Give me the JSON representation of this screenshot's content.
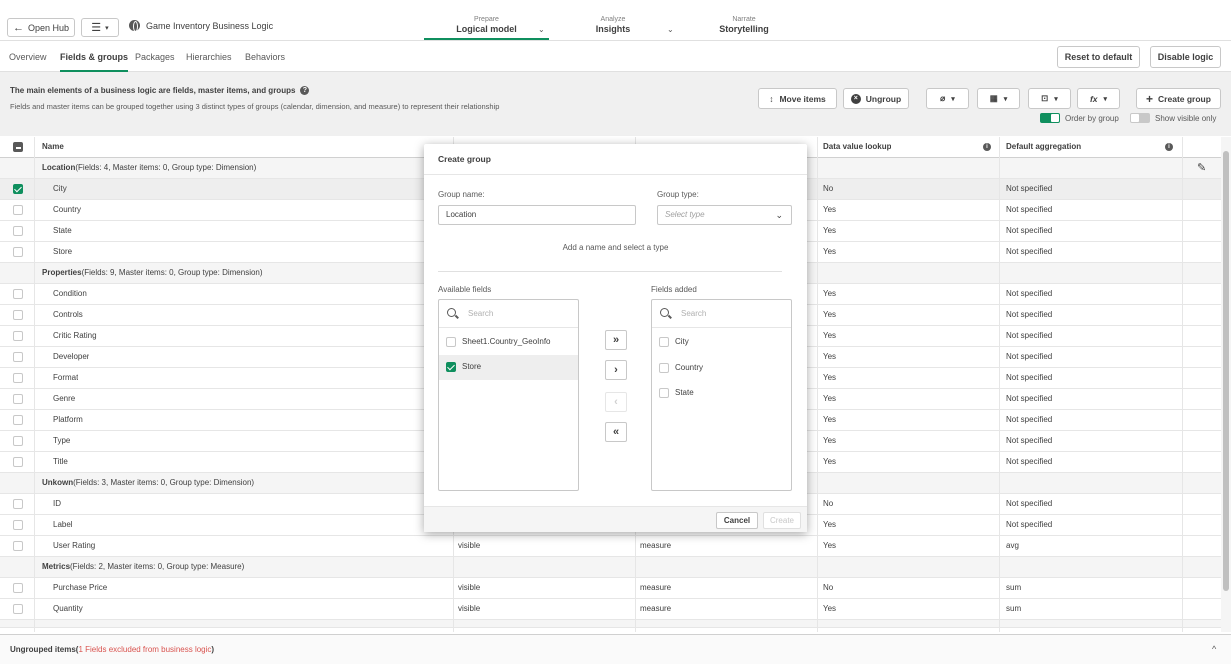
{
  "header": {
    "open_hub": "Open Hub",
    "app_title": "Game Inventory Business Logic",
    "nav": [
      {
        "small": "Prepare",
        "big": "Logical model"
      },
      {
        "small": "Analyze",
        "big": "Insights"
      },
      {
        "small": "Narrate",
        "big": "Storytelling"
      }
    ]
  },
  "tabs": [
    "Overview",
    "Fields & groups",
    "Packages",
    "Hierarchies",
    "Behaviors"
  ],
  "actions": {
    "reset": "Reset to default",
    "disable": "Disable logic"
  },
  "info": {
    "title": "The main elements of a business logic are fields, master items, and groups",
    "subtitle": "Fields and master items can be grouped together using 3 distinct types of groups (calendar, dimension, and measure) to represent their relationship"
  },
  "toolbar": {
    "move_items": "Move items",
    "ungroup": "Ungroup",
    "create_group": "Create group",
    "order_by_group": "Order by group",
    "show_visible_only": "Show visible only"
  },
  "table": {
    "headers": {
      "name": "Name",
      "lookup": "Data value lookup",
      "aggregation": "Default aggregation"
    },
    "groups": [
      {
        "title": "Location",
        "meta": "(Fields: 4, Master items: 0, Group type: Dimension)"
      },
      {
        "title": "Properties",
        "meta": "(Fields: 9, Master items: 0, Group type: Dimension)"
      },
      {
        "title": "Unkown",
        "meta": "(Fields: 3, Master items: 0, Group type: Dimension)"
      },
      {
        "title": "Metrics",
        "meta": "(Fields: 2, Master items: 0, Group type: Measure)"
      }
    ],
    "rows": [
      {
        "name": "City",
        "vis": "",
        "type": "",
        "lookup": "No",
        "agg": "Not specified"
      },
      {
        "name": "Country",
        "vis": "",
        "type": "",
        "lookup": "Yes",
        "agg": "Not specified"
      },
      {
        "name": "State",
        "vis": "",
        "type": "",
        "lookup": "Yes",
        "agg": "Not specified"
      },
      {
        "name": "Store",
        "vis": "",
        "type": "",
        "lookup": "Yes",
        "agg": "Not specified"
      },
      {
        "name": "Condition",
        "vis": "",
        "type": "",
        "lookup": "Yes",
        "agg": "Not specified"
      },
      {
        "name": "Controls",
        "vis": "",
        "type": "",
        "lookup": "Yes",
        "agg": "Not specified"
      },
      {
        "name": "Critic Rating",
        "vis": "",
        "type": "",
        "lookup": "Yes",
        "agg": "Not specified"
      },
      {
        "name": "Developer",
        "vis": "",
        "type": "",
        "lookup": "Yes",
        "agg": "Not specified"
      },
      {
        "name": "Format",
        "vis": "",
        "type": "",
        "lookup": "Yes",
        "agg": "Not specified"
      },
      {
        "name": "Genre",
        "vis": "",
        "type": "",
        "lookup": "Yes",
        "agg": "Not specified"
      },
      {
        "name": "Platform",
        "vis": "",
        "type": "",
        "lookup": "Yes",
        "agg": "Not specified"
      },
      {
        "name": "Type",
        "vis": "",
        "type": "",
        "lookup": "Yes",
        "agg": "Not specified"
      },
      {
        "name": "Title",
        "vis": "",
        "type": "",
        "lookup": "Yes",
        "agg": "Not specified"
      },
      {
        "name": "ID",
        "vis": "",
        "type": "",
        "lookup": "No",
        "agg": "Not specified"
      },
      {
        "name": "Label",
        "vis": "",
        "type": "",
        "lookup": "Yes",
        "agg": "Not specified"
      },
      {
        "name": "User Rating",
        "vis": "visible",
        "type": "measure",
        "lookup": "Yes",
        "agg": "avg"
      },
      {
        "name": "Purchase Price",
        "vis": "visible",
        "type": "measure",
        "lookup": "No",
        "agg": "sum"
      },
      {
        "name": "Quantity",
        "vis": "visible",
        "type": "measure",
        "lookup": "Yes",
        "agg": "sum"
      }
    ]
  },
  "bottom": {
    "label": "Ungrouped items",
    "excluded": "1 Fields excluded from business logic"
  },
  "dialog": {
    "title": "Create group",
    "group_name_label": "Group name:",
    "group_name_value": "Location",
    "group_type_label": "Group type:",
    "group_type_placeholder": "Select type",
    "hint": "Add a name and select a type",
    "available_label": "Available fields",
    "added_label": "Fields added",
    "search_placeholder": "Search",
    "available": [
      "Sheet1.Country_GeoInfo",
      "Store"
    ],
    "added": [
      "City",
      "Country",
      "State"
    ],
    "cancel": "Cancel",
    "create": "Create"
  }
}
